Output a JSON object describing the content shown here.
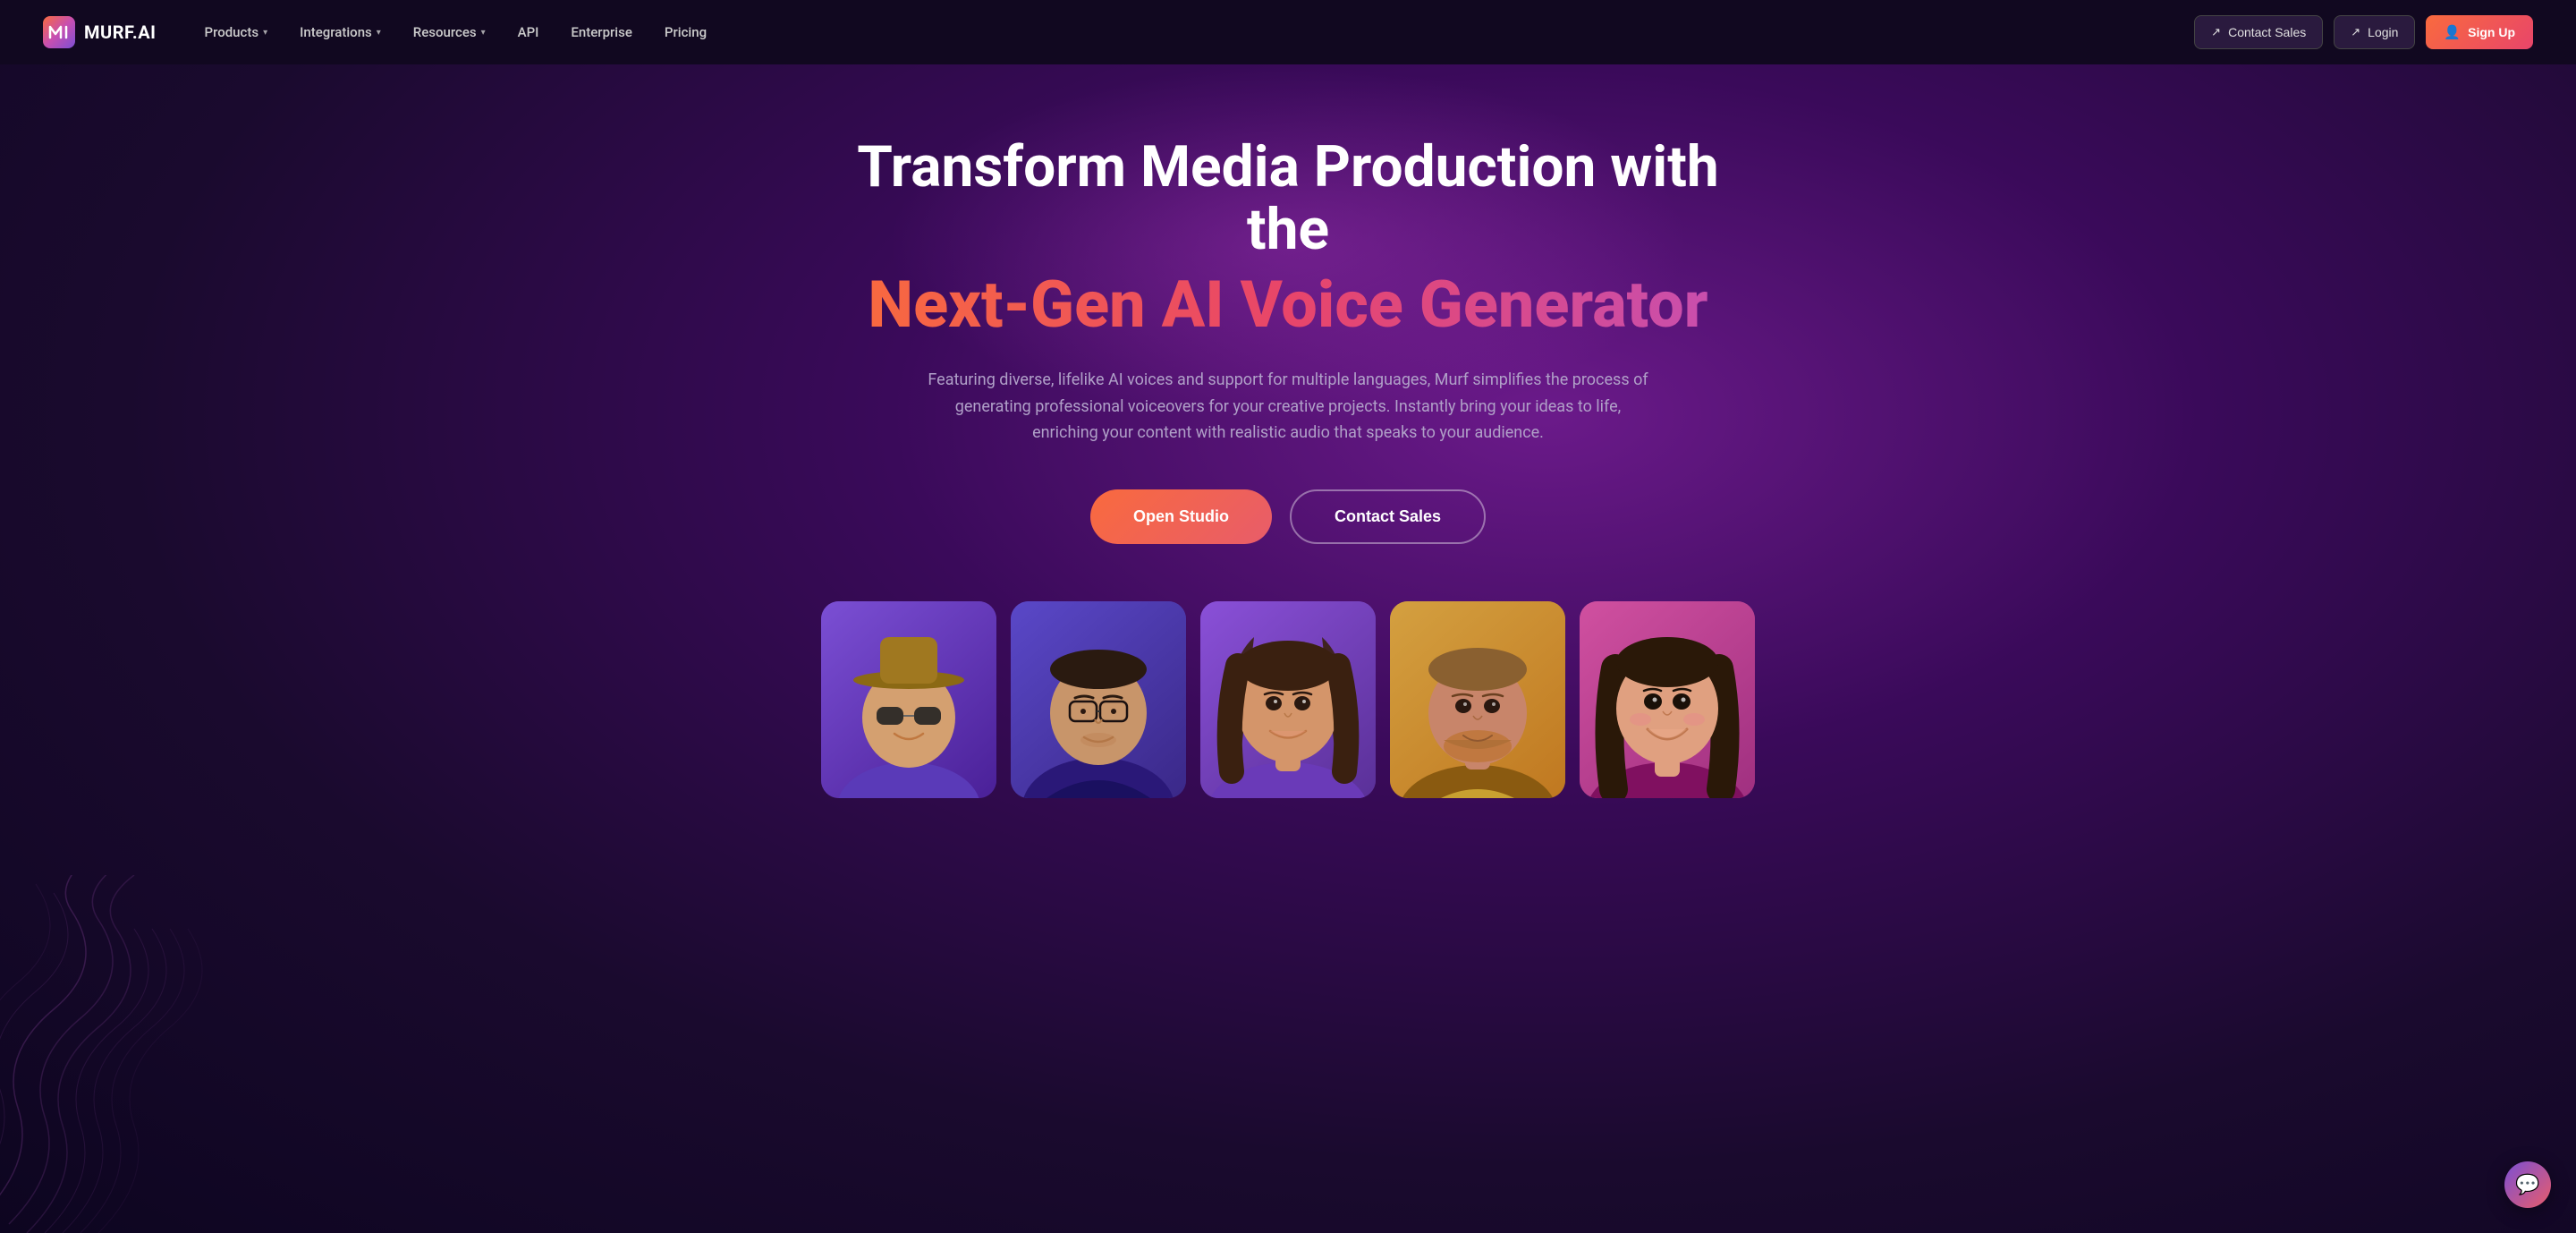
{
  "brand": {
    "name": "MURF.AI",
    "logo_alt": "Murf AI Logo"
  },
  "nav": {
    "links": [
      {
        "id": "products",
        "label": "Products",
        "hasDropdown": true
      },
      {
        "id": "integrations",
        "label": "Integrations",
        "hasDropdown": true
      },
      {
        "id": "resources",
        "label": "Resources",
        "hasDropdown": true
      },
      {
        "id": "api",
        "label": "API",
        "hasDropdown": false
      },
      {
        "id": "enterprise",
        "label": "Enterprise",
        "hasDropdown": false
      },
      {
        "id": "pricing",
        "label": "Pricing",
        "hasDropdown": false
      }
    ],
    "contact_sales": "Contact Sales",
    "login": "Login",
    "signup": "Sign Up"
  },
  "hero": {
    "title_line1": "Transform Media Production with the",
    "title_line2": "Next-Gen AI Voice Generator",
    "subtitle": "Featuring diverse, lifelike AI voices and support for multiple languages, Murf simplifies the process of generating professional voiceovers for your creative projects. Instantly bring your ideas to life, enriching your content with realistic audio that speaks to your audience.",
    "cta_primary": "Open Studio",
    "cta_secondary": "Contact Sales"
  },
  "avatar_cards": [
    {
      "id": 1,
      "bg_class": "card-1",
      "emoji": "🧑‍🦳",
      "description": "Person with hat and sunglasses"
    },
    {
      "id": 2,
      "bg_class": "card-2",
      "emoji": "👨‍💼",
      "description": "Man with glasses"
    },
    {
      "id": 3,
      "bg_class": "card-3",
      "emoji": "👩‍💼",
      "description": "Woman smiling"
    },
    {
      "id": 4,
      "bg_class": "card-4",
      "emoji": "👨",
      "description": "Man with beard"
    },
    {
      "id": 5,
      "bg_class": "card-5",
      "emoji": "👩",
      "description": "Young woman smiling"
    }
  ],
  "chat": {
    "icon": "💬"
  },
  "colors": {
    "nav_bg": "#110820",
    "hero_bg_start": "#6b1a8a",
    "hero_bg_end": "#0d0520",
    "gradient_text_start": "#f96a3e",
    "gradient_text_end": "#c84fb0",
    "cta_primary_start": "#f96a3e",
    "cta_primary_end": "#e85c6a"
  }
}
